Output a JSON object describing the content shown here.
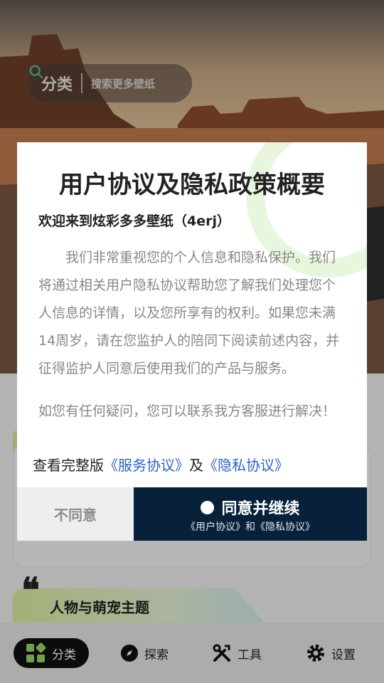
{
  "header": {
    "category_label": "分类",
    "search_placeholder": "搜索更多壁纸"
  },
  "section": {
    "title": "人物与萌宠主题"
  },
  "nav": {
    "items": [
      {
        "label": "分类",
        "icon": "grid-icon",
        "active": true
      },
      {
        "label": "探索",
        "icon": "compass-icon",
        "active": false
      },
      {
        "label": "工具",
        "icon": "tools-icon",
        "active": false
      },
      {
        "label": "设置",
        "icon": "gear-icon",
        "active": false
      }
    ]
  },
  "dialog": {
    "title": "用户协议及隐私政策概要",
    "welcome": "欢迎来到炫彩多多壁纸（4erj）",
    "body": "我们非常重视您的个人信息和隐私保护。我们将通过相关用户隐私协议帮助您了解我们处理您个人信息的详情，以及您所享有的权利。如果您未满14周岁，请在您监护人的陪同下阅读前述内容，并征得监护人同意后使用我们的产品与服务。",
    "contact": "如您有任何疑问，您可以联系我方客服进行解决！",
    "links_prefix": "查看完整版",
    "service_link": "《服务协议》",
    "links_and": "及",
    "privacy_link": "《隐私协议》",
    "disagree_label": "不同意",
    "agree_label": "同意并继续",
    "agree_sub": "《用户协议》和《隐私协议》"
  },
  "colors": {
    "agree_bg": "#07213a",
    "link": "#2d62c8",
    "accent_green": "#d4ea9a"
  }
}
